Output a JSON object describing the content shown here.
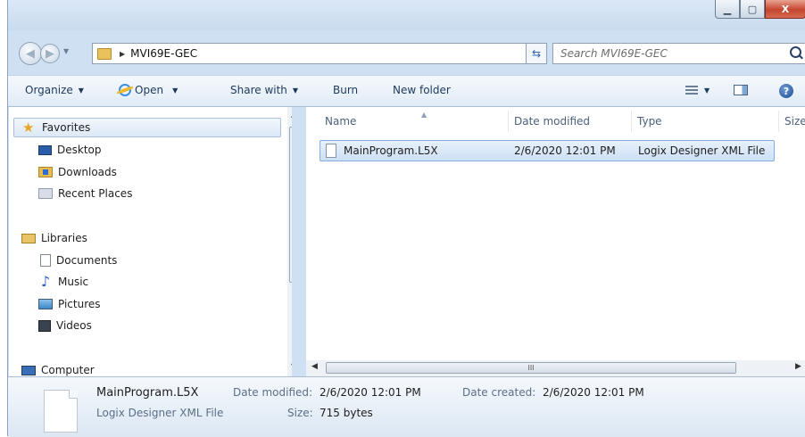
{
  "window": {
    "minimize_glyph": "▁",
    "maximize_glyph": "▢",
    "close_glyph": "X"
  },
  "address_bar": {
    "path": "MVI69E-GEC",
    "separator_glyph": "▶",
    "dropdown_glyph": "▼",
    "refresh_glyph": "⇆"
  },
  "search": {
    "placeholder": "Search MVI69E-GEC"
  },
  "toolbar": {
    "organize": "Organize",
    "open": "Open",
    "share_with": "Share with",
    "burn": "Burn",
    "new_folder": "New folder",
    "caret": "▼",
    "help_glyph": "?"
  },
  "nav": {
    "favorites": "Favorites",
    "desktop": "Desktop",
    "downloads": "Downloads",
    "recent_places": "Recent Places",
    "libraries": "Libraries",
    "documents": "Documents",
    "music": "Music",
    "pictures": "Pictures",
    "videos": "Videos",
    "computer": "Computer"
  },
  "columns": {
    "name": "Name",
    "date_modified": "Date modified",
    "type": "Type",
    "size": "Size"
  },
  "files": [
    {
      "name": "MainProgram.L5X",
      "date_modified": "2/6/2020 12:01 PM",
      "type": "Logix Designer XML File"
    }
  ],
  "scroll": {
    "up": "▲",
    "down": "▼",
    "left": "◀",
    "right": "▶",
    "grip": "III"
  },
  "details": {
    "file_name": "MainProgram.L5X",
    "file_type": "Logix Designer XML File",
    "date_modified_label": "Date modified:",
    "date_modified_value": "2/6/2020 12:01 PM",
    "date_created_label": "Date created:",
    "date_created_value": "2/6/2020 12:01 PM",
    "size_label": "Size:",
    "size_value": "715 bytes"
  }
}
